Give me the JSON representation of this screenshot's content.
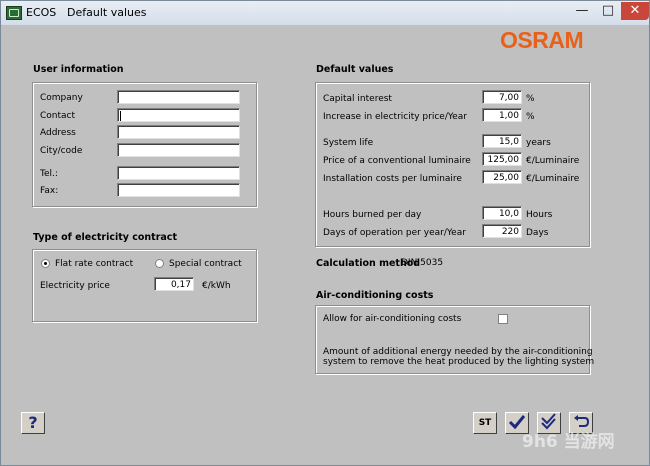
{
  "window": {
    "app": "ECOS",
    "title": "Default values",
    "minimize": "—",
    "maximize": "□",
    "close": "✕"
  },
  "logo": "OSRAM",
  "user_info": {
    "heading": "User information",
    "company_label": "Company",
    "contact_label": "Contact",
    "address_label": "Address",
    "city_label": "City/code",
    "tel_label": "Tel.:",
    "fax_label": "Fax:"
  },
  "contract": {
    "heading": "Type of electricity contract",
    "flat_rate": "Flat rate contract",
    "special": "Special contract",
    "selected": "flat_rate",
    "price_label": "Electricity price",
    "price_value": "0,17",
    "price_unit": "€/kWh"
  },
  "defaults": {
    "heading": "Default values",
    "capital_interest_label": "Capital interest",
    "capital_interest_value": "7,00",
    "capital_interest_unit": "%",
    "increase_label": "Increase in electricity price/Year",
    "increase_value": "1,00",
    "increase_unit": "%",
    "system_life_label": "System life",
    "system_life_value": "15,0",
    "system_life_unit": "years",
    "luminaire_price_label": "Price of a conventional luminaire",
    "luminaire_price_value": "125,00",
    "luminaire_price_unit": "€/Luminaire",
    "installation_label": "Installation costs per luminaire",
    "installation_value": "25,00",
    "installation_unit": "€/Luminaire",
    "hours_label": "Hours burned per day",
    "hours_value": "10,0",
    "hours_unit": "Hours",
    "days_label": "Days of operation per year/Year",
    "days_value": "220",
    "days_unit": "Days"
  },
  "calc": {
    "label": "Calculation method",
    "value": "DIN 5035"
  },
  "aircon": {
    "heading": "Air-conditioning costs",
    "allow_label": "Allow for air-conditioning costs",
    "allow_checked": false,
    "note_line1": "Amount of additional energy needed by the air-conditioning",
    "note_line2": "system to remove the heat produced by the lighting system"
  },
  "buttons": {
    "help": "?",
    "st": "ST"
  },
  "watermark": "9h6 当游网"
}
